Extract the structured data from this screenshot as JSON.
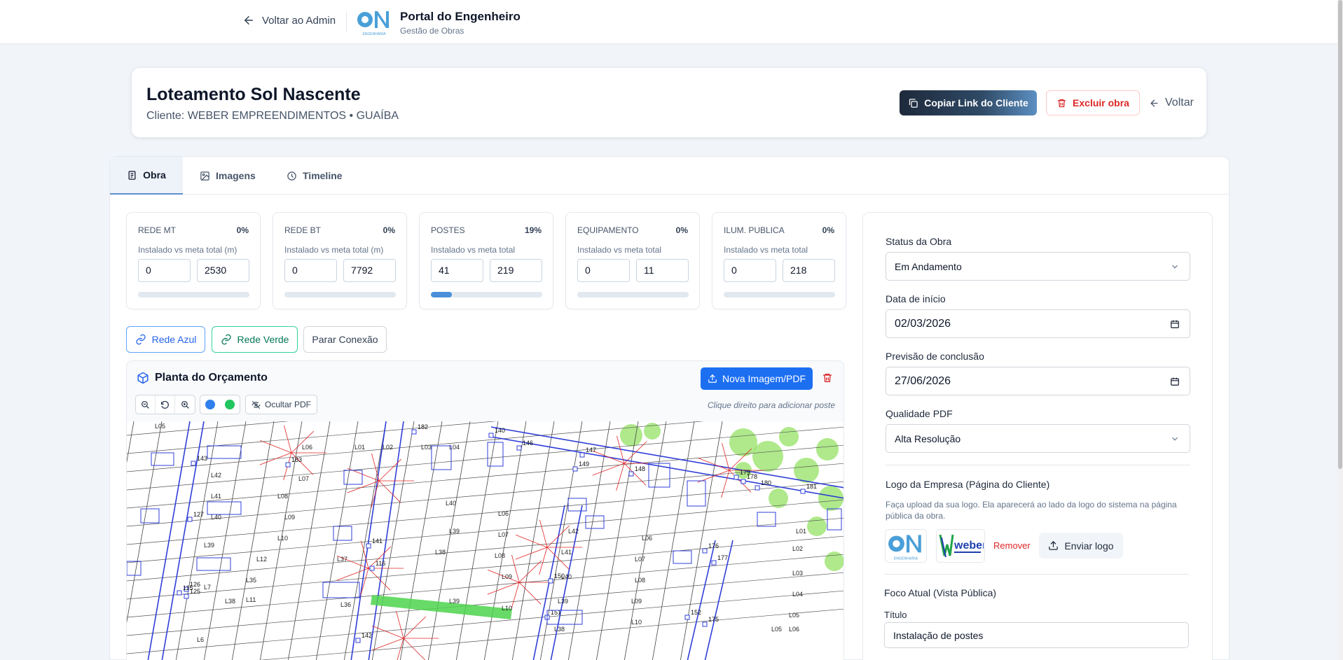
{
  "topbar": {
    "back_label": "Voltar ao Admin",
    "brand_title": "Portal do Engenheiro",
    "brand_subtitle": "Gestão de Obras",
    "logo_text": "oN",
    "logo_caption": "ENGENHARIA"
  },
  "project": {
    "title": "Loteamento Sol Nascente",
    "client_line": "Cliente: WEBER EMPREENDIMENTOS • GUAÍBA",
    "copy_link_label": "Copiar Link do Cliente",
    "delete_label": "Excluir obra",
    "back_label": "Voltar"
  },
  "tabs": [
    {
      "label": "Obra",
      "icon": "clipboard-icon",
      "active": true
    },
    {
      "label": "Imagens",
      "icon": "image-icon",
      "active": false
    },
    {
      "label": "Timeline",
      "icon": "clock-icon",
      "active": false
    }
  ],
  "metrics": [
    {
      "name": "REDE MT",
      "percent": "0%",
      "desc": "Instalado vs meta total (m)",
      "installed": "0",
      "target": "2530",
      "progress": 0
    },
    {
      "name": "REDE BT",
      "percent": "0%",
      "desc": "Instalado vs meta total (m)",
      "installed": "0",
      "target": "7792",
      "progress": 0
    },
    {
      "name": "POSTES",
      "percent": "19%",
      "desc": "Instalado vs meta total",
      "installed": "41",
      "target": "219",
      "progress": 0.19
    },
    {
      "name": "EQUIPAMENTO",
      "percent": "0%",
      "desc": "Instalado vs meta total",
      "installed": "0",
      "target": "11",
      "progress": 0
    },
    {
      "name": "ILUM. PUBLICA",
      "percent": "0%",
      "desc": "Instalado vs meta total",
      "installed": "0",
      "target": "218",
      "progress": 0
    }
  ],
  "connections": {
    "blue_label": "Rede Azul",
    "green_label": "Rede Verde",
    "stop_label": "Parar Conexão"
  },
  "plan": {
    "title": "Planta do Orçamento",
    "new_image_label": "Nova Imagem/PDF",
    "hide_pdf_label": "Ocultar PDF",
    "hint": "Clique direito para adicionar poste",
    "colors": {
      "blue": "#2f80ed",
      "green": "#22c55e"
    },
    "pole_labels": [
      "143",
      "127",
      "126",
      "115",
      "125",
      "116",
      "141",
      "142",
      "140",
      "146",
      "147",
      "148",
      "149",
      "150",
      "151",
      "152",
      "175",
      "176",
      "177",
      "178",
      "179",
      "180",
      "181",
      "182",
      "183"
    ],
    "lot_labels": [
      "L05",
      "L42",
      "L41",
      "L40",
      "L39",
      "L38",
      "L7",
      "L6",
      "L35",
      "L11",
      "L12",
      "L10",
      "L09",
      "L08",
      "L07",
      "L06",
      "L01",
      "L02",
      "L03",
      "L04",
      "L37",
      "L36",
      "L40",
      "L39",
      "L38",
      "L06",
      "L07",
      "L08",
      "L09",
      "L10",
      "L42",
      "L41",
      "L40",
      "L39",
      "L38",
      "L06",
      "L07",
      "L08",
      "L09",
      "L10",
      "L01",
      "L02",
      "L03",
      "L04",
      "L05",
      "L06",
      "L05",
      "L39"
    ]
  },
  "side": {
    "status_label": "Status da Obra",
    "status_value": "Em Andamento",
    "start_label": "Data de início",
    "start_value": "02/03/2026",
    "end_label": "Previsão de conclusão",
    "end_value": "27/06/2026",
    "quality_label": "Qualidade PDF",
    "quality_value": "Alta Resolução",
    "logo_heading": "Logo da Empresa (Página do Cliente)",
    "logo_help": "Faça upload da sua logo. Ela aparecerá ao lado da logo do sistema na página pública da obra.",
    "client_logo_text": "weber",
    "remove_label": "Remover",
    "upload_label": "Enviar logo",
    "focus_heading": "Foco Atual (Vista Pública)",
    "focus_title_label": "Título",
    "focus_title_value": "Instalação de postes"
  }
}
